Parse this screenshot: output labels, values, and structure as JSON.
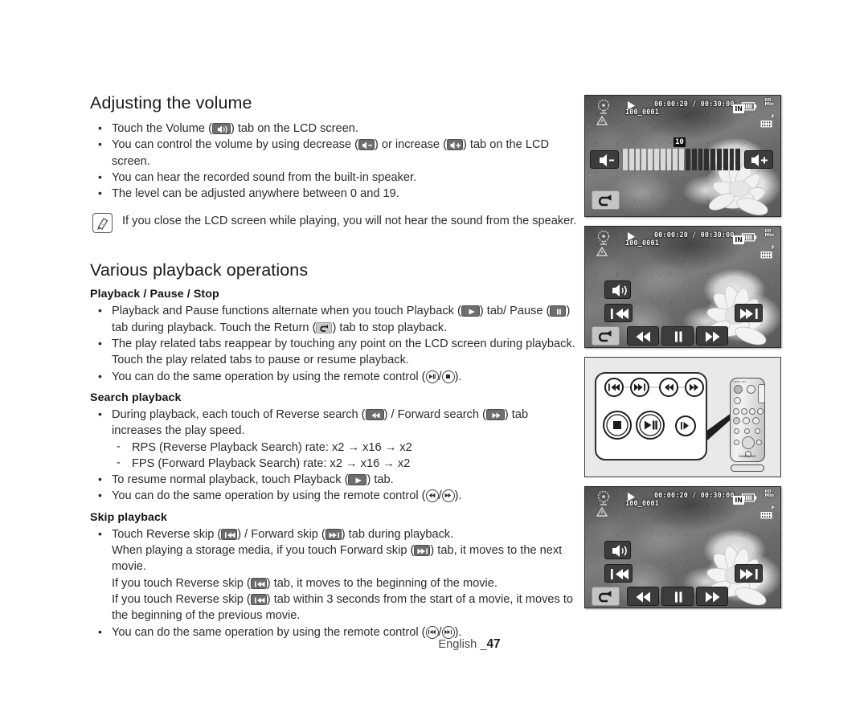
{
  "page": {
    "footer_lang": "English _",
    "footer_number": "47"
  },
  "sections": [
    {
      "id": "adjusting-volume",
      "title": "Adjusting the volume",
      "bullets": [
        {
          "parts": [
            {
              "t": "text",
              "v": "Touch the Volume ("
            },
            {
              "t": "icon",
              "v": "volume-tab-icon"
            },
            {
              "t": "text",
              "v": ") tab on the LCD screen."
            }
          ]
        },
        {
          "parts": [
            {
              "t": "text",
              "v": "You can control the volume by using decrease ("
            },
            {
              "t": "icon",
              "v": "volume-decrease-tab-icon"
            },
            {
              "t": "text",
              "v": ") or increase ("
            },
            {
              "t": "icon",
              "v": "volume-increase-tab-icon"
            },
            {
              "t": "text",
              "v": ") tab on the LCD screen."
            }
          ]
        },
        {
          "parts": [
            {
              "t": "text",
              "v": "You can hear the recorded sound from the built-in speaker."
            }
          ]
        },
        {
          "parts": [
            {
              "t": "text",
              "v": "The level can be adjusted anywhere between 0 and 19."
            }
          ]
        }
      ],
      "note": "If you close the LCD screen while playing, you will not hear the sound from the speaker."
    },
    {
      "id": "various-playback-operations",
      "title": "Various playback operations",
      "subsections": [
        {
          "heading": "Playback / Pause / Stop",
          "bullets": [
            {
              "parts": [
                {
                  "t": "text",
                  "v": "Playback and Pause functions alternate when you touch Playback ("
                },
                {
                  "t": "icon",
                  "v": "play-tab-icon"
                },
                {
                  "t": "text",
                  "v": ") tab/ Pause ("
                },
                {
                  "t": "icon",
                  "v": "pause-tab-icon"
                },
                {
                  "t": "text",
                  "v": ") tab during playback. Touch the Return ("
                },
                {
                  "t": "icon",
                  "v": "return-tab-icon"
                },
                {
                  "t": "text",
                  "v": ") tab to stop playback."
                }
              ]
            },
            {
              "parts": [
                {
                  "t": "text",
                  "v": "The play related tabs reappear by touching any point on the LCD screen during playback. Touch the play related tabs to pause or resume playback."
                }
              ]
            },
            {
              "parts": [
                {
                  "t": "text",
                  "v": "You can do the same operation by using the remote control ("
                },
                {
                  "t": "rc",
                  "v": "remote-play-pause-icon"
                },
                {
                  "t": "text",
                  "v": "/"
                },
                {
                  "t": "rc",
                  "v": "remote-stop-icon"
                },
                {
                  "t": "text",
                  "v": ")."
                }
              ]
            }
          ]
        },
        {
          "heading": "Search playback",
          "bullets": [
            {
              "parts": [
                {
                  "t": "text",
                  "v": "During playback, each touch of Reverse search ("
                },
                {
                  "t": "icon",
                  "v": "reverse-search-tab-icon"
                },
                {
                  "t": "text",
                  "v": ") / Forward search ("
                },
                {
                  "t": "icon",
                  "v": "forward-search-tab-icon"
                },
                {
                  "t": "text",
                  "v": ") tab increases the play speed."
                }
              ]
            }
          ],
          "dashes": [
            "RPS (Reverse Playback Search) rate: x2 → x16 → x2",
            "FPS (Forward Playback Search) rate: x2 → x16 → x2"
          ],
          "bullets_after": [
            {
              "parts": [
                {
                  "t": "text",
                  "v": "To resume normal playback, touch Playback ("
                },
                {
                  "t": "icon",
                  "v": "play-tab-icon"
                },
                {
                  "t": "text",
                  "v": ") tab."
                }
              ]
            },
            {
              "parts": [
                {
                  "t": "text",
                  "v": "You can do the same operation by using the remote control ("
                },
                {
                  "t": "rc",
                  "v": "remote-reverse-search-icon"
                },
                {
                  "t": "text",
                  "v": "/"
                },
                {
                  "t": "rc",
                  "v": "remote-forward-search-icon"
                },
                {
                  "t": "text",
                  "v": ")."
                }
              ]
            }
          ]
        },
        {
          "heading": "Skip playback",
          "bullets": [
            {
              "parts": [
                {
                  "t": "text",
                  "v": "Touch Reverse skip ("
                },
                {
                  "t": "icon",
                  "v": "reverse-skip-tab-icon"
                },
                {
                  "t": "text",
                  "v": ") / Forward skip ("
                },
                {
                  "t": "icon",
                  "v": "forward-skip-tab-icon"
                },
                {
                  "t": "text",
                  "v": ") tab during playback."
                }
              ]
            },
            {
              "nodot": true,
              "parts": [
                {
                  "t": "text",
                  "v": "When playing a storage media, if you touch Forward skip ("
                },
                {
                  "t": "icon",
                  "v": "forward-skip-tab-icon"
                },
                {
                  "t": "text",
                  "v": ") tab, it moves to the next movie."
                }
              ]
            },
            {
              "nodot": true,
              "parts": [
                {
                  "t": "text",
                  "v": "If you touch Reverse skip ("
                },
                {
                  "t": "icon",
                  "v": "reverse-skip-tab-icon"
                },
                {
                  "t": "text",
                  "v": ") tab, it moves to the beginning of the movie."
                }
              ]
            },
            {
              "nodot": true,
              "parts": [
                {
                  "t": "text",
                  "v": "If you touch Reverse skip ("
                },
                {
                  "t": "icon",
                  "v": "reverse-skip-tab-icon"
                },
                {
                  "t": "text",
                  "v": ") tab within 3 seconds from the start of a movie, it moves to the beginning of the previous movie."
                }
              ]
            },
            {
              "parts": [
                {
                  "t": "text",
                  "v": "You can do the same operation by using the remote control ("
                },
                {
                  "t": "rc",
                  "v": "remote-reverse-skip-icon"
                },
                {
                  "t": "text",
                  "v": "/"
                },
                {
                  "t": "rc",
                  "v": "remote-forward-skip-icon"
                },
                {
                  "t": "text",
                  "v": ")."
                }
              ]
            }
          ]
        }
      ]
    }
  ],
  "lcd_screens": [
    {
      "id": "volume-screen",
      "osd": {
        "time": "00:00:20 / 00:30:00",
        "file": "100_0001",
        "storage_badge": "IN",
        "battery_minutes": "60",
        "battery_unit": "Min",
        "quality": "F"
      },
      "volume_level": "10",
      "volume_total_bars": 19,
      "volume_filled_bars": 10,
      "tabs": [
        "volume-decrease",
        "volume-increase",
        "return"
      ]
    },
    {
      "id": "playback-controls-screen-upper",
      "osd": {
        "time": "00:00:20 / 00:30:00",
        "file": "100_0001",
        "storage_badge": "IN",
        "battery_minutes": "60",
        "battery_unit": "Min",
        "quality": "F"
      },
      "tabs": [
        "volume",
        "reverse-skip",
        "forward-skip",
        "return",
        "reverse-search",
        "pause",
        "forward-search"
      ]
    },
    {
      "id": "playback-controls-screen-lower",
      "osd": {
        "time": "00:00:20 / 00:30:00",
        "file": "100_0001",
        "storage_badge": "IN",
        "battery_minutes": "60",
        "battery_unit": "Min",
        "quality": "F"
      },
      "tabs": [
        "volume",
        "reverse-skip",
        "forward-skip",
        "return",
        "reverse-search",
        "pause",
        "forward-search"
      ]
    }
  ],
  "remote_panel": {
    "id": "remote-control-illustration",
    "brand": "SAMSUNG",
    "callout_buttons": [
      "reverse-skip-button",
      "forward-skip-button",
      "reverse-search-button",
      "forward-search-button",
      "stop-button",
      "play-pause-button",
      "slow-button"
    ]
  }
}
